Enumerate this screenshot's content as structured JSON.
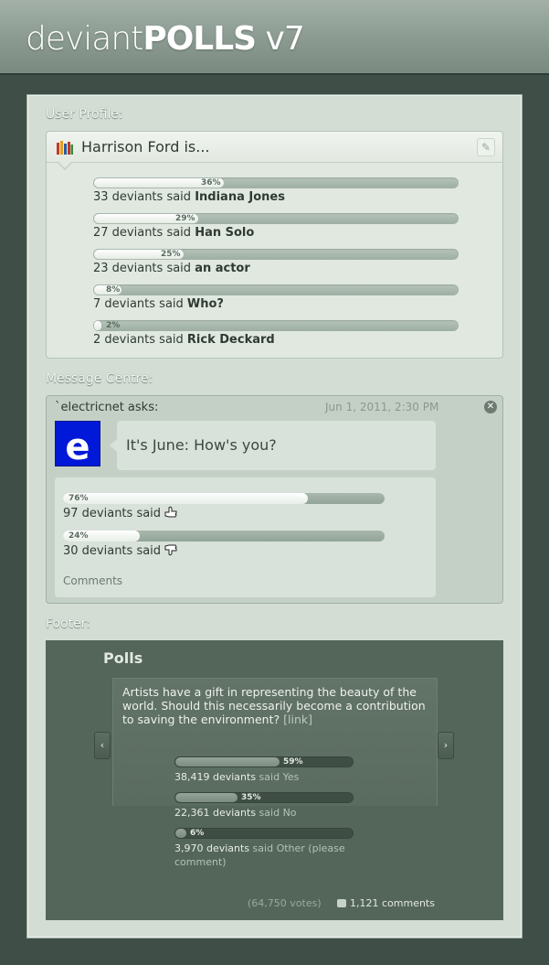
{
  "header": {
    "brand_prefix": "deviant",
    "brand_main": "POLLS",
    "brand_version": " v7"
  },
  "sections": {
    "profile": "User Profile:",
    "messages": "Message Centre:",
    "footer": "Footer:"
  },
  "profile_poll": {
    "title": "Harrison Ford is...",
    "icon": "books-icon",
    "edit_icon": "pencil-icon",
    "results": [
      {
        "pct": "36%",
        "value": 0.36,
        "count": "33 deviants said ",
        "answer": "Indiana Jones"
      },
      {
        "pct": "29%",
        "value": 0.29,
        "count": "27 deviants said ",
        "answer": "Han Solo"
      },
      {
        "pct": "25%",
        "value": 0.25,
        "count": "23 deviants said ",
        "answer": "an actor"
      },
      {
        "pct": "8%",
        "value": 0.08,
        "count": "7 deviants said ",
        "answer": "Who?"
      },
      {
        "pct": "2%",
        "value": 0.02,
        "count": "2 deviants said ",
        "answer": "Rick Deckard"
      }
    ]
  },
  "message": {
    "author": "`electricnet",
    "asks": " asks:",
    "date": "Jun 1, 2011, 2:30 PM",
    "avatar_letter": "e",
    "question": "It's June: How's you?",
    "results": [
      {
        "pct": "76%",
        "value": 0.76,
        "count": "97 deviants said",
        "icon": "thumbs-up-hand-icon"
      },
      {
        "pct": "24%",
        "value": 0.24,
        "count": "30 deviants said",
        "icon": "thumbs-down-hand-icon"
      }
    ],
    "comments": "Comments"
  },
  "footer_poll": {
    "title": "Polls",
    "question": "Artists have a gift in representing the beauty of the world. Should this necessarily become a contribution to saving the environment?",
    "link": "[link]",
    "prev": "‹",
    "next": "›",
    "results": [
      {
        "pct": "59%",
        "value": 0.59,
        "count": "38,419 deviants",
        "said": " said Yes"
      },
      {
        "pct": "35%",
        "value": 0.35,
        "count": "22,361 deviants",
        "said": " said No"
      },
      {
        "pct": "6%",
        "value": 0.06,
        "count": "3,970 deviants",
        "said": " said Other (please comment)"
      }
    ],
    "votes": "(64,750 votes)",
    "comments": "1,121 comments"
  }
}
